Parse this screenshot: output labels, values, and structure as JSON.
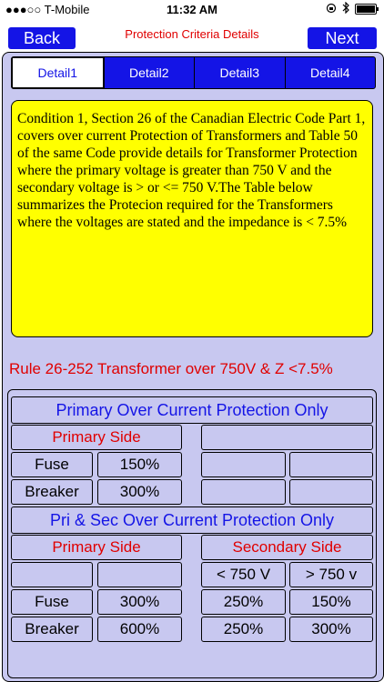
{
  "status_bar": {
    "carrier": "●●●○○ T-Mobile",
    "time": "11:32 AM"
  },
  "nav": {
    "back_label": "Back",
    "title": "Protection Criteria Details",
    "next_label": "Next"
  },
  "tabs": [
    {
      "label": "Detail1",
      "active": true
    },
    {
      "label": "Detail2",
      "active": false
    },
    {
      "label": "Detail3",
      "active": false
    },
    {
      "label": "Detail4",
      "active": false
    }
  ],
  "description": "Condition 1, Section 26 of the Canadian Electric Code Part 1, covers over current Protection of Transformers and Table 50 of the same Code provide details for Transformer Protection where the primary voltage is greater than 750 V and the secondary voltage is > or <= 750 V.The Table below summarizes the Protecion required for the Transformers where the voltages are stated and the impedance is < 7.5%",
  "rule": "Rule 26-252 Transformer over 750V & Z <7.5%",
  "table": {
    "primary_only_header": "Primary Over Current Protection Only",
    "primary_side_label": "Primary Side",
    "fuse_label": "Fuse",
    "breaker_label": "Breaker",
    "primary_only_fuse": "150%",
    "primary_only_breaker": "300%",
    "pri_sec_header": "Pri & Sec Over Current Protection Only",
    "secondary_side_label": "Secondary Side",
    "sec_col1_header": "< 750 V",
    "sec_col2_header": "> 750 v",
    "pri_sec_fuse_primary": "300%",
    "pri_sec_fuse_sec_lt": "250%",
    "pri_sec_fuse_sec_gt": "150%",
    "pri_sec_breaker_primary": "600%",
    "pri_sec_breaker_sec_lt": "250%",
    "pri_sec_breaker_sec_gt": "300%"
  },
  "colors": {
    "accent_blue": "#1414e6",
    "label_red": "#e00000",
    "panel_bg": "#c8c8f0",
    "note_yellow": "#ffff00"
  }
}
